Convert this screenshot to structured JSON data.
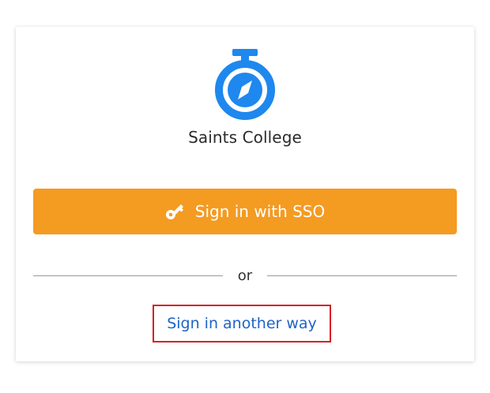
{
  "org": {
    "name": "Saints College",
    "logo_icon": "compass-stopwatch-logo",
    "logo_color": "#1e88ee"
  },
  "sso_button": {
    "label": "Sign in with SSO",
    "icon": "key-icon",
    "background": "#f49b22"
  },
  "divider": {
    "text": "or"
  },
  "alt_signin": {
    "label": "Sign in another way",
    "color": "#1f63c6",
    "highlight_border": "#d81f26"
  }
}
